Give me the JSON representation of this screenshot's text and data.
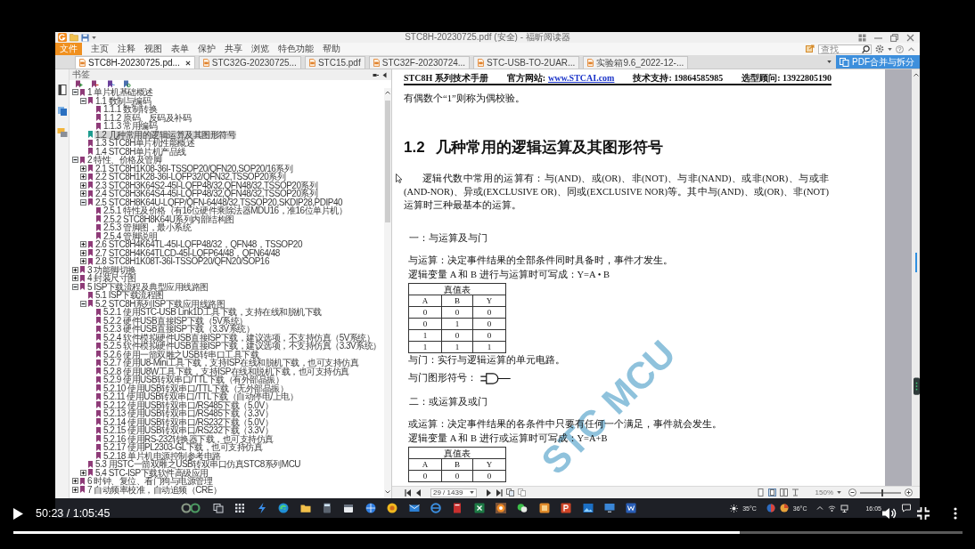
{
  "reader": {
    "title": "STC8H-20230725.pdf (安全) - 福昕阅读器",
    "file_menu": "文件",
    "menu": [
      "主页",
      "注释",
      "视图",
      "表单",
      "保护",
      "共享",
      "浏览",
      "特色功能",
      "帮助"
    ],
    "search": {
      "placeholder": "查找"
    },
    "tabs": [
      {
        "label": "STC8H-20230725.pd...",
        "selected": true
      },
      {
        "label": "STC32G-20230725...",
        "selected": false
      },
      {
        "label": "STC15.pdf",
        "selected": false
      },
      {
        "label": "STC32F-20230724...",
        "selected": false
      },
      {
        "label": "STC-USB-TO-2UAR...",
        "selected": false
      },
      {
        "label": "实验箱9.6_2022-12-...",
        "selected": false
      }
    ],
    "merge_button": "PDF合并与拆分",
    "sidebar": {
      "title": "书签",
      "bookmarks": [
        {
          "label": "1 单片机基础概述",
          "expanded": true,
          "selected": false,
          "children": [
            {
              "label": "1.1 数制与编码",
              "expanded": true,
              "selected": false,
              "children": [
                {
                  "label": "1.1.1 数制转换",
                  "selected": false
                },
                {
                  "label": "1.1.2 原码、反码及补码",
                  "selected": false
                },
                {
                  "label": "1.1.3 常用编码",
                  "selected": false
                }
              ]
            },
            {
              "label": "1.2 几种常用的逻辑运算及其图形符号",
              "selected": true
            },
            {
              "label": "1.3 STC8H单片机性能概述",
              "selected": false
            },
            {
              "label": "1.4 STC8H单片机产品线",
              "selected": false
            }
          ]
        },
        {
          "label": "2 特性、价格及管脚",
          "expanded": true,
          "selected": false,
          "children": [
            {
              "label": "2.1 STC8H1K08-36I-TSSOP20/QFN20,SOP20/16系列",
              "expanded": false,
              "selected": false
            },
            {
              "label": "2.2 STC8H1K28-36I-LQFP32/QFN32,TSSOP20系列",
              "expanded": false,
              "selected": false
            },
            {
              "label": "2.3 STC8H3K64S2-45I-LQFP48/32,QFN48/32,TSSOP20系列",
              "expanded": false,
              "selected": false
            },
            {
              "label": "2.4 STC8H3K64S4-45I-LQFP48/32,QFN48/32,TSSOP20系列",
              "expanded": false,
              "selected": false
            },
            {
              "label": "2.5 STC8H8K64U-LQFP/QFN-64/48/32,TSSOP20,SKDIP28,PDIP40",
              "expanded": true,
              "selected": false,
              "children": [
                {
                  "label": "2.5.1 特性及价格（有16位硬件乘除法器MDU16，准16位单片机）",
                  "selected": false
                },
                {
                  "label": "2.5.2 STC8H8K64U系列内部结构图",
                  "selected": false
                },
                {
                  "label": "2.5.3 管脚图，最小系统",
                  "selected": false
                },
                {
                  "label": "2.5.4 管脚说明",
                  "selected": false
                }
              ]
            },
            {
              "label": "2.6 STC8H4K64TL-45I-LQFP48/32，QFN48，TSSOP20",
              "expanded": false,
              "selected": false
            },
            {
              "label": "2.7 STC8H4K64TLCD-45I-LQFP64/48，QFN64/48",
              "expanded": false,
              "selected": false
            },
            {
              "label": "2.8 STC8H1K08T-36I-TSSOP20/QFN20/SOP16",
              "expanded": false,
              "selected": false
            }
          ]
        },
        {
          "label": "3 功能脚切换",
          "expanded": false,
          "selected": false
        },
        {
          "label": "4 封装尺寸图",
          "expanded": false,
          "selected": false
        },
        {
          "label": "5 ISP下载流程及典型应用线路图",
          "expanded": true,
          "selected": false,
          "children": [
            {
              "label": "5.1 ISP下载流程图",
              "selected": false
            },
            {
              "label": "5.2 STC8H系列ISP下载应用线路图",
              "expanded": true,
              "selected": false,
              "children": [
                {
                  "label": "5.2.1 使用STC-USB Link1D工具下载，支持在线和脱机下载",
                  "selected": false
                },
                {
                  "label": "5.2.2 硬件USB直接ISP下载（5V系统）",
                  "selected": false
                },
                {
                  "label": "5.2.3 硬件USB直接ISP下载（3.3V系统）",
                  "selected": false
                },
                {
                  "label": "5.2.4 软件模拟硬件USB直接ISP下载，建议选项，不支持仿真（5V系统）",
                  "selected": false
                },
                {
                  "label": "5.2.5 软件模拟硬件USB直接ISP下载，建议选项，不支持仿真（3.3V系统）",
                  "selected": false
                },
                {
                  "label": "5.2.6 使用一箭双雕之USB转串口工具下载",
                  "selected": false
                },
                {
                  "label": "5.2.7 使用U8-Mini工具下载，支持ISP在线和脱机下载，也可支持仿真",
                  "selected": false
                },
                {
                  "label": "5.2.8 使用U8W工具下载，支持ISP在线和脱机下载，也可支持仿真",
                  "selected": false
                },
                {
                  "label": "5.2.9 使用USB转双串口/TTL下载（有外部晶振）",
                  "selected": false
                },
                {
                  "label": "5.2.10 使用USB转双串口/TTL下载（无外部晶振）",
                  "selected": false
                },
                {
                  "label": "5.2.11 使用USB转双串口/TTL下载（自动停电/上电）",
                  "selected": false
                },
                {
                  "label": "5.2.12 使用USB转双串口/RS485下载（5.0V）",
                  "selected": false
                },
                {
                  "label": "5.2.13 使用USB转双串口/RS485下载（3.3V）",
                  "selected": false
                },
                {
                  "label": "5.2.14 使用USB转双串口/RS232下载（5.0V）",
                  "selected": false
                },
                {
                  "label": "5.2.15 使用USB转双串口/RS232下载（3.3V）",
                  "selected": false
                },
                {
                  "label": "5.2.16 使用RS-232转换器下载，也可支持仿真",
                  "selected": false
                },
                {
                  "label": "5.2.17 使用PL2303-GL下载，也可支持仿真",
                  "selected": false
                },
                {
                  "label": "5.2.18 单片机电源控制参考电路",
                  "selected": false
                }
              ]
            },
            {
              "label": "5.3 用STC一箭双雕之USB转双串口仿真STC8系列MCU",
              "selected": false
            },
            {
              "label": "5.4 STC-ISP下载软件高级应用",
              "expanded": false,
              "selected": false
            }
          ]
        },
        {
          "label": "6 时钟、复位、看门狗与电源管理",
          "expanded": false,
          "selected": false
        },
        {
          "label": "7 自动频率校准，自动追频（CRE）",
          "expanded": false,
          "selected": false
        }
      ]
    },
    "document": {
      "header": {
        "title": "STC8H 系列技术手册",
        "website_label": "官方网站:",
        "website": "www.STCAI.com",
        "support": "技术支持: 19864585985",
        "advisor": "选型顾问: 13922805190"
      },
      "blocks": [
        {
          "kind": "text",
          "text": "有偶数个“1”则称为偶校验。"
        },
        {
          "kind": "heading",
          "text": "1.2 几种常用的逻辑运算及其图形符号"
        },
        {
          "kind": "paragraph",
          "text": "逻辑代数中常用的运算有：与(AND)、或(OR)、非(NOT)、与非(NAND)、或非(NOR)、与或非(AND-NOR)、异或(EXCLUSIVE OR)、同或(EXCLUSIVE NOR)等。其中与(AND)、或(OR)、非(NOT)运算时三种最基本的运算。"
        },
        {
          "kind": "subheading",
          "text": "一：与运算及与门"
        },
        {
          "kind": "text",
          "text": "与运算：决定事件结果的全部条件同时具备时，事件才发生。"
        },
        {
          "kind": "text",
          "text": "逻辑变量 A 和 B 进行与运算时可写成：Y=A • B"
        },
        {
          "kind": "table",
          "title": "真值表",
          "columns": [
            "A",
            "B",
            "Y"
          ],
          "rows": [
            [
              "0",
              "0",
              "0"
            ],
            [
              "0",
              "1",
              "0"
            ],
            [
              "1",
              "0",
              "0"
            ],
            [
              "1",
              "1",
              "1"
            ]
          ]
        },
        {
          "kind": "text",
          "text": "与门：实行与逻辑运算的单元电路。"
        },
        {
          "kind": "symbol",
          "text": "与门图形符号："
        },
        {
          "kind": "subheading",
          "text": "二：或运算及或门"
        },
        {
          "kind": "text",
          "text": "或运算：决定事件结果的各条件中只要有任何一个满足，事件就会发生。"
        },
        {
          "kind": "text",
          "text": "逻辑变量 A 和 B 进行或运算时可写成：Y=A+B"
        },
        {
          "kind": "table",
          "title": "真值表",
          "columns": [
            "A",
            "B",
            "Y"
          ],
          "rows": [
            [
              "0",
              "0",
              "0"
            ]
          ]
        }
      ],
      "watermark": "STC MCU"
    },
    "status_bar": {
      "page": "29 / 1439",
      "zoom": "150%",
      "zoom_slider": {
        "level": 0.55
      }
    }
  },
  "taskbar": {
    "weather": "35°C",
    "temperature": "36°C",
    "clock": "16:05"
  },
  "player": {
    "time": "50:23 / 1:05:45",
    "progress": {
      "level": 0.765
    }
  }
}
